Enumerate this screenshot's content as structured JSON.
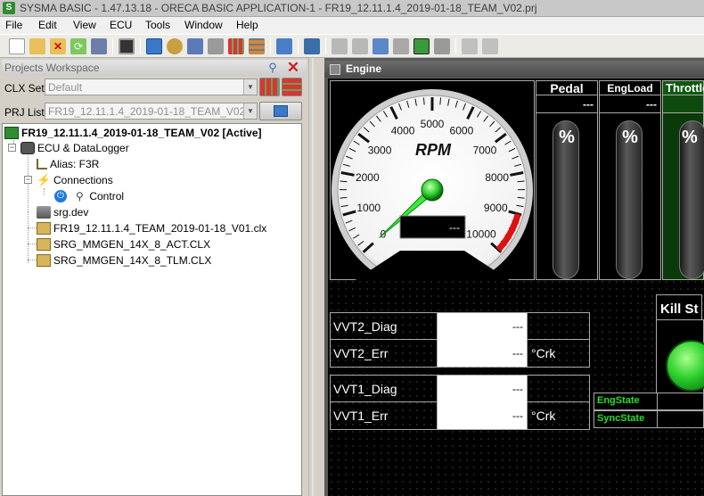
{
  "titlebar": {
    "app_icon": "S",
    "title": "SYSMA BASIC - 1.47.13.18 - ORECA BASIC APPLICATION-1 - FR19_12.11.1.4_2019-01-18_TEAM_V02.prj"
  },
  "menu": [
    "File",
    "Edit",
    "View",
    "ECU",
    "Tools",
    "Window",
    "Help"
  ],
  "toolbar": {
    "icons": [
      "new-file-icon",
      "open-folder-icon",
      "delete-icon",
      "refresh-icon",
      "save-icon",
      "monitor-icon",
      "cube-blue-icon",
      "settings-gear-icon",
      "tool-icon",
      "disk-icon",
      "grid-red-icon",
      "grid-multi-icon",
      "export-icon",
      "network-icon",
      "layout-grid-icon",
      "layout-list-icon",
      "hierarchy-icon",
      "hierarchy-alt-icon",
      "maximize-icon",
      "restore-icon",
      "chart-icon",
      "chart-alt-icon"
    ]
  },
  "workspace": {
    "title": "Projects Workspace",
    "clx_label": "CLX Set:",
    "clx_value": "Default",
    "prj_label": "PRJ List:",
    "prj_value": "FR19_12.11.1.4_2019-01-18_TEAM_V02"
  },
  "tree": {
    "root": "FR19_12.11.1.4_2019-01-18_TEAM_V02 [Active]",
    "ecu": "ECU & DataLogger",
    "alias": "Alias: F3R",
    "connections": "Connections",
    "control": "Control",
    "dev": "srg.dev",
    "clx1": "FR19_12.11.1.4_TEAM_2019-01-18_V01.clx",
    "clx2": "SRG_MMGEN_14X_8_ACT.CLX",
    "clx3": "SRG_MMGEN_14X_8_TLM.CLX"
  },
  "engine": {
    "title": "Engine",
    "gauge": {
      "label": "RPM",
      "ticks": [
        "0",
        "1000",
        "2000",
        "3000",
        "4000",
        "5000",
        "6000",
        "7000",
        "8000",
        "9000",
        "10000"
      ],
      "readout": "---"
    },
    "bars": [
      {
        "name": "Pedal",
        "value": "---",
        "unit": "%"
      },
      {
        "name": "EngLoad",
        "value": "---",
        "unit": "%"
      },
      {
        "name": "Throttle",
        "value": "",
        "unit": "%"
      }
    ],
    "diag1": [
      {
        "label": "VVT2_Diag",
        "value": "---",
        "unit": ""
      },
      {
        "label": "VVT2_Err",
        "value": "---",
        "unit": "°Crk"
      }
    ],
    "diag2": [
      {
        "label": "VVT1_Diag",
        "value": "---",
        "unit": ""
      },
      {
        "label": "VVT1_Err",
        "value": "---",
        "unit": "°Crk"
      }
    ],
    "kill_switch": "Kill St",
    "states": [
      "EngState",
      "SyncState"
    ]
  },
  "colors": {
    "accent_green": "#2fd12f",
    "redline": "#e01010",
    "close_red": "#d22020"
  }
}
